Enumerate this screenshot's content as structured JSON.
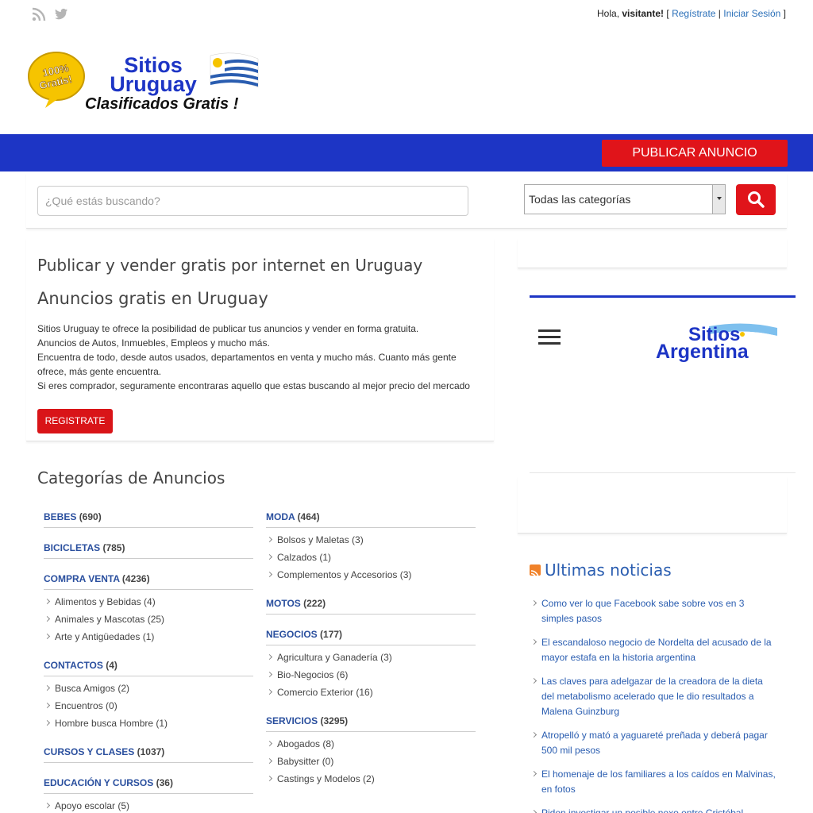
{
  "header": {
    "greeting": "Hola,",
    "visitor": "visitante!",
    "register_link": "Regístrate",
    "login_link": "Iniciar Sesión",
    "separator": "|",
    "bracket_open": "[",
    "bracket_close": "]"
  },
  "logo": {
    "badge": "100% Gratis!",
    "line1": "Sitios",
    "line2": "Uruguay",
    "tagline": "Clasificados Gratis !"
  },
  "nav": {
    "publish_button": "PUBLICAR ANUNCIO"
  },
  "search": {
    "placeholder": "¿Qué estás buscando?",
    "category_selected": "Todas las categorías"
  },
  "intro": {
    "title": "Publicar y vender gratis por internet en Uruguay",
    "subtitle": "Anuncios gratis en Uruguay",
    "lines": [
      "Sitios Uruguay te ofrece la posibilidad de publicar tus anuncios y vender en forma gratuita.",
      "Anuncios de Autos, Inmuebles, Empleos y mucho más.",
      "Encuentra de todo, desde autos usados, departamentos en venta y mucho más. Cuanto más gente ofrece, más gente encuentra.",
      "Si eres comprador, seguramente encontraras aquello que estas buscando al mejor precio del mercado"
    ],
    "register_button": "REGISTRATE"
  },
  "categories": {
    "title": "Categorías de Anuncios",
    "col1": [
      {
        "name": "BEBES",
        "count": "(690)",
        "subs": []
      },
      {
        "name": "BICICLETAS",
        "count": "(785)",
        "subs": []
      },
      {
        "name": "COMPRA VENTA",
        "count": "(4236)",
        "subs": [
          "Alimentos y Bebidas (4)",
          "Animales y Mascotas (25)",
          "Arte y Antigüedades (1)"
        ]
      },
      {
        "name": "CONTACTOS",
        "count": "(4)",
        "subs": [
          "Busca Amigos (2)",
          "Encuentros (0)",
          "Hombre busca Hombre (1)"
        ]
      },
      {
        "name": "CURSOS Y CLASES",
        "count": "(1037)",
        "subs": []
      },
      {
        "name": "EDUCACIÓN Y CURSOS",
        "count": "(36)",
        "subs": [
          "Apoyo escolar (5)"
        ]
      }
    ],
    "col2": [
      {
        "name": "MODA",
        "count": "(464)",
        "subs": [
          "Bolsos y Maletas (3)",
          "Calzados (1)",
          "Complementos y Accesorios (3)"
        ]
      },
      {
        "name": "MOTOS",
        "count": "(222)",
        "subs": []
      },
      {
        "name": "NEGOCIOS",
        "count": "(177)",
        "subs": [
          "Agricultura y Ganadería (3)",
          "Bio-Negocios (6)",
          "Comercio Exterior (16)"
        ]
      },
      {
        "name": "SERVICIOS",
        "count": "(3295)",
        "subs": [
          "Abogados (8)",
          "Babysitter (0)",
          "Castings y Modelos (2)"
        ]
      }
    ]
  },
  "ad": {
    "logo_line1": "Sitios",
    "logo_line2": "Argentina"
  },
  "news": {
    "title": "Ultimas noticias",
    "items": [
      "Como ver lo que Facebook sabe sobre vos en 3 simples pasos",
      "El escandaloso negocio de Nordelta del acusado de la mayor estafa en la historia argentina",
      "Las claves para adelgazar de la creadora de la dieta del metabolismo acelerado que le dio resultados a Malena Guinzburg",
      "Atropelló y mató a yaguareté preñada y deberá pagar 500 mil pesos",
      "El homenaje de los familiares a los caídos en Malvinas, en fotos",
      "Piden investigar un posible nexo entre Cristóbal"
    ]
  },
  "colors": {
    "brand_blue": "#1d35c5",
    "accent_red": "#e0141a",
    "link": "#2a5db0"
  }
}
